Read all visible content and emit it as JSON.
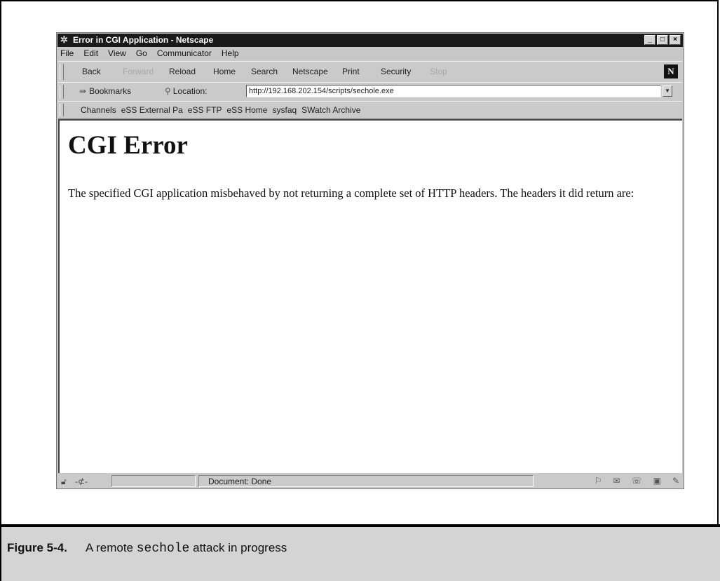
{
  "window": {
    "title": "Error in CGI Application - Netscape",
    "controls": {
      "minimize": "_",
      "maximize": "□",
      "close": "×"
    }
  },
  "menu": [
    "File",
    "Edit",
    "View",
    "Go",
    "Communicator",
    "Help"
  ],
  "nav": {
    "back": "Back",
    "forward": "Forward",
    "reload": "Reload",
    "home": "Home",
    "search": "Search",
    "netscape": "Netscape",
    "print": "Print",
    "security": "Security",
    "stop": "Stop",
    "logo": "N"
  },
  "location": {
    "bookmarks_label": "Bookmarks",
    "location_label": "Location:",
    "url": "http://192.168.202.154/scripts/sechole.exe"
  },
  "personal_toolbar": [
    "Channels",
    "eSS External Pa",
    "eSS FTP",
    "eSS Home",
    "sysfaq",
    "SWatch Archive"
  ],
  "page": {
    "heading": "CGI Error",
    "body": "The specified CGI application misbehaved by not returning a complete set of HTTP headers. The headers it did return are:"
  },
  "status": {
    "text": "Document: Done"
  },
  "figure": {
    "number": "Figure 5-4.",
    "caption_prefix": "A remote",
    "caption_code": "sechole",
    "caption_suffix": "attack in progress"
  },
  "icons": [
    "app-icon",
    "bookmarks-icon",
    "location-icon",
    "security-lock-icon",
    "connection-icon",
    "component-bar-icons"
  ]
}
